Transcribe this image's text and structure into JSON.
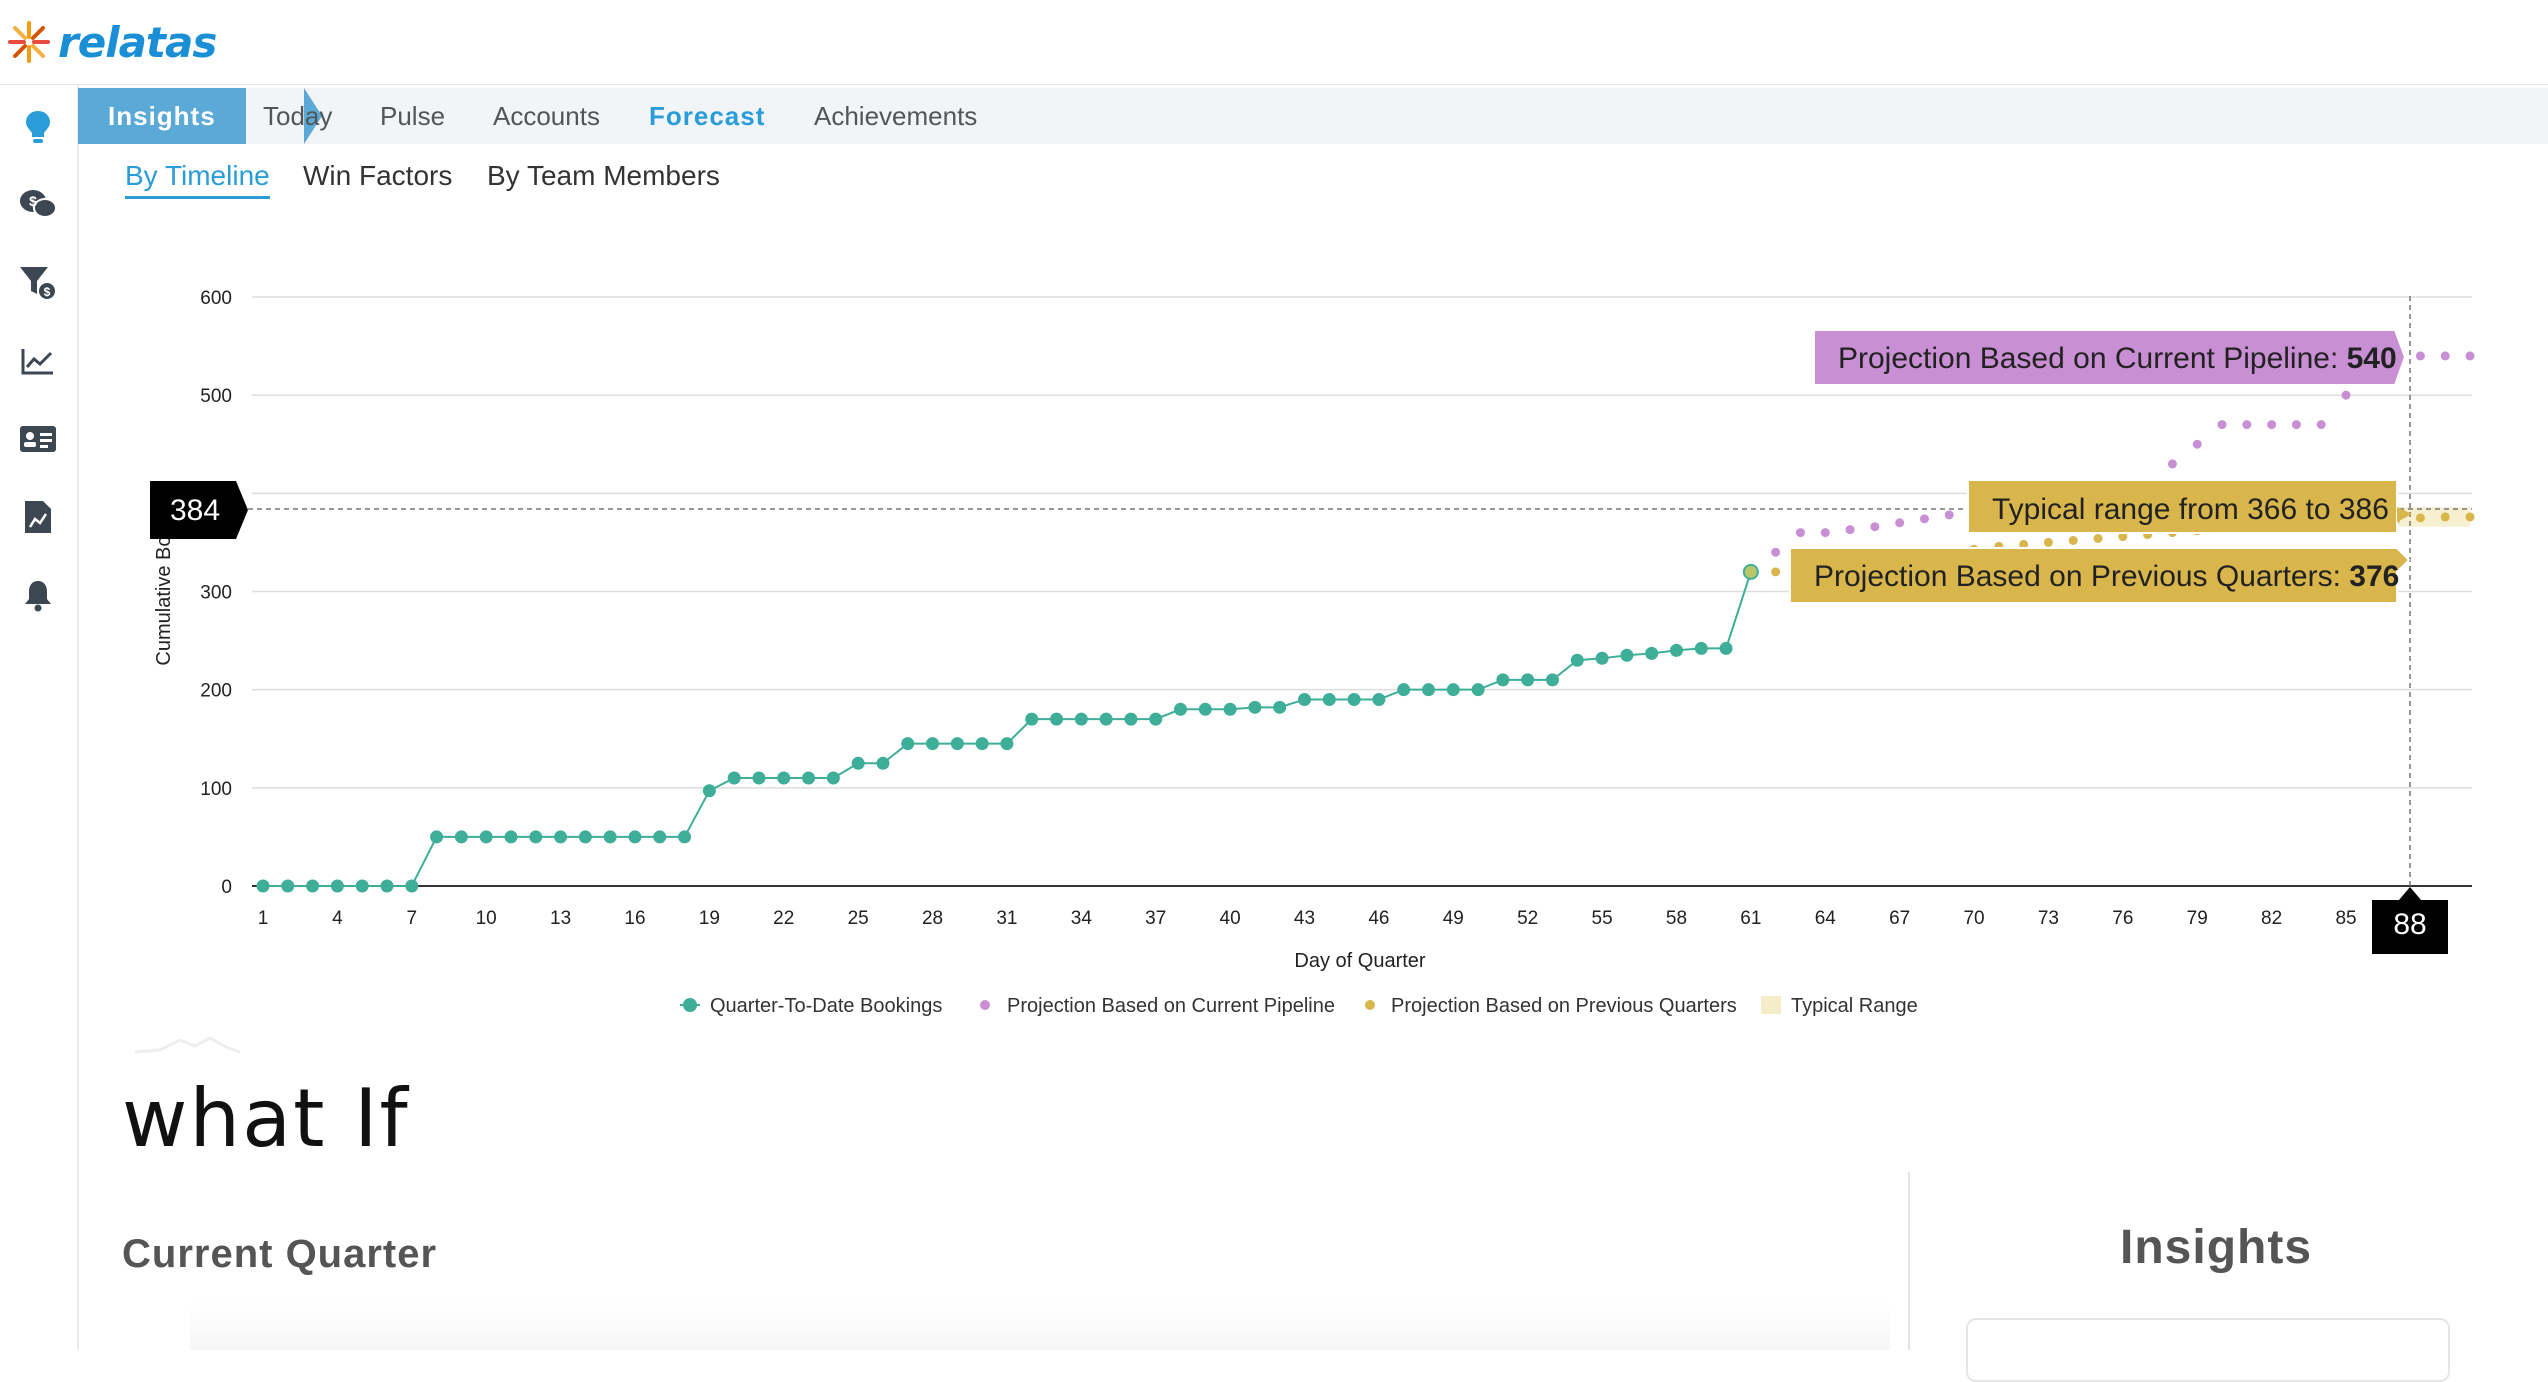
{
  "brand": {
    "name": "relatas"
  },
  "nav": {
    "tabs": [
      {
        "label": "Insights",
        "active": true
      },
      {
        "label": "Today"
      },
      {
        "label": "Pulse"
      },
      {
        "label": "Accounts"
      },
      {
        "label": "Forecast",
        "highlight": true
      },
      {
        "label": "Achievements"
      }
    ]
  },
  "sidebar": {
    "icons": [
      "lightbulb-icon",
      "chat-dollar-icon",
      "funnel-dollar-icon",
      "trend-chart-icon",
      "contact-card-icon",
      "report-icon",
      "bell-icon"
    ]
  },
  "subtabs": [
    {
      "label": "By Timeline",
      "active": true
    },
    {
      "label": "Win Factors"
    },
    {
      "label": "By Team Members"
    }
  ],
  "chart_data": {
    "type": "line",
    "xlabel": "Day of Quarter",
    "ylabel": "Cumulative Book",
    "ylim": [
      0,
      600
    ],
    "xlim": [
      1,
      90
    ],
    "yticks": [
      0,
      100,
      200,
      300,
      500,
      600
    ],
    "xticks": [
      1,
      4,
      7,
      10,
      13,
      16,
      19,
      22,
      25,
      28,
      31,
      34,
      37,
      40,
      43,
      46,
      49,
      52,
      55,
      58,
      61,
      64,
      67,
      70,
      73,
      76,
      79,
      82,
      85
    ],
    "grid": true,
    "legend_position": "bottom",
    "series": [
      {
        "name": "Quarter-To-Date Bookings",
        "color": "#3fae99",
        "x": [
          1,
          2,
          3,
          4,
          5,
          6,
          7,
          8,
          9,
          10,
          11,
          12,
          13,
          14,
          15,
          16,
          17,
          18,
          19,
          20,
          21,
          22,
          23,
          24,
          25,
          26,
          27,
          28,
          29,
          30,
          31,
          32,
          33,
          34,
          35,
          36,
          37,
          38,
          39,
          40,
          41,
          42,
          43,
          44,
          45,
          46,
          47,
          48,
          49,
          50,
          51,
          52,
          53,
          54,
          55,
          56,
          57,
          58,
          59,
          60,
          61
        ],
        "values": [
          0,
          0,
          0,
          0,
          0,
          0,
          0,
          50,
          50,
          50,
          50,
          50,
          50,
          50,
          50,
          50,
          50,
          50,
          97,
          110,
          110,
          110,
          110,
          110,
          125,
          125,
          145,
          145,
          145,
          145,
          145,
          170,
          170,
          170,
          170,
          170,
          170,
          180,
          180,
          180,
          182,
          182,
          190,
          190,
          190,
          190,
          200,
          200,
          200,
          200,
          210,
          210,
          210,
          230,
          232,
          235,
          237,
          240,
          242,
          242,
          320
        ]
      },
      {
        "name": "Projection Based on Current Pipeline",
        "color": "#c98fd4",
        "x": [
          62,
          63,
          64,
          65,
          66,
          67,
          68,
          69,
          70,
          71,
          72,
          73,
          74,
          75,
          76,
          77,
          78,
          79,
          80,
          81,
          82,
          83,
          84,
          85,
          86,
          87,
          88,
          89,
          90
        ],
        "values": [
          340,
          360,
          360,
          363,
          366,
          370,
          374,
          378,
          381,
          383,
          385,
          386,
          388,
          390,
          392,
          395,
          430,
          450,
          470,
          470,
          470,
          470,
          470,
          500,
          520,
          530,
          540,
          540,
          540
        ]
      },
      {
        "name": "Projection Based on Previous Quarters",
        "color": "#d9b64c",
        "x": [
          62,
          63,
          64,
          65,
          66,
          67,
          68,
          69,
          70,
          71,
          72,
          73,
          74,
          75,
          76,
          77,
          78,
          79,
          80,
          81,
          82,
          83,
          84,
          85,
          86,
          87,
          88,
          89,
          90
        ],
        "values": [
          320,
          320,
          322,
          325,
          330,
          334,
          337,
          340,
          343,
          346,
          348,
          350,
          352,
          354,
          356,
          358,
          360,
          362,
          364,
          366,
          368,
          369,
          370,
          371,
          372,
          373,
          375,
          376,
          376
        ]
      }
    ],
    "legend_extra": "Typical Range",
    "typical_range": [
      366,
      386
    ],
    "crosshair": {
      "x": 88,
      "y": 384
    },
    "tooltips": {
      "pipeline_prefix": "Projection Based on Current Pipeline: ",
      "pipeline_value": "540",
      "range_text": "Typical range from 366 to 386",
      "prev_prefix": "Projection Based on Previous Quarters: ",
      "prev_value": "376"
    },
    "flags": {
      "y_value": "384",
      "x_value": "88"
    }
  },
  "whatif": {
    "title": "what If"
  },
  "current_quarter": {
    "title": "Current Quarter"
  },
  "insights_panel": {
    "title": "Insights"
  }
}
